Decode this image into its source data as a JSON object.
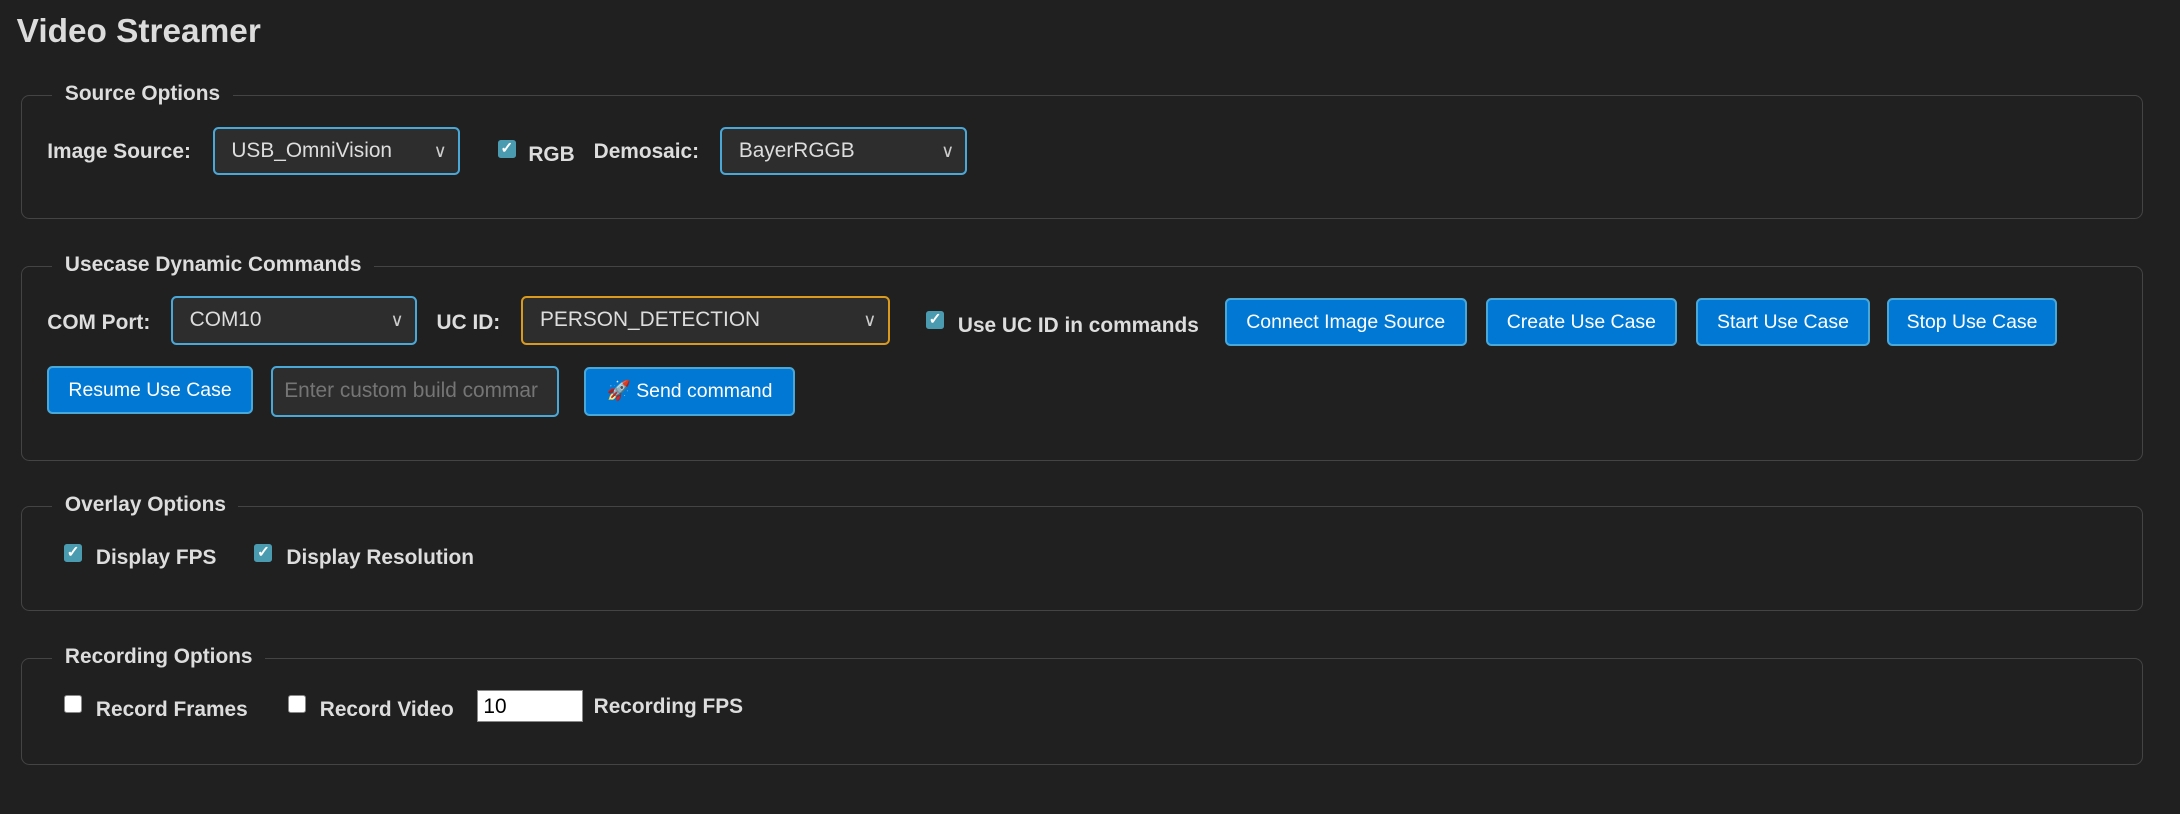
{
  "title": "Video Streamer",
  "source_options": {
    "legend": "Source Options",
    "image_source_label": "Image Source:",
    "image_source_value": "USB_OmniVision",
    "rgb_label": "RGB",
    "rgb_checked": true,
    "demosaic_label": "Demosaic:",
    "demosaic_value": "BayerRGGB"
  },
  "usecase": {
    "legend": "Usecase Dynamic Commands",
    "com_port_label": "COM Port:",
    "com_port_value": "COM10",
    "uc_id_label": "UC ID:",
    "uc_id_value": "PERSON_DETECTION",
    "use_uc_id_label": "Use UC ID in commands",
    "use_uc_id_checked": true,
    "buttons": {
      "connect": "Connect Image Source",
      "create": "Create Use Case",
      "start": "Start Use Case",
      "stop": "Stop Use Case",
      "resume": "Resume Use Case",
      "send": "Send command"
    },
    "send_icon": "🚀",
    "custom_command_placeholder": "Enter custom build commar"
  },
  "overlay": {
    "legend": "Overlay Options",
    "display_fps_label": "Display FPS",
    "display_resolution_label": "Display Resolution"
  },
  "recording": {
    "legend": "Recording Options",
    "record_frames_label": "Record Frames",
    "record_video_label": "Record Video",
    "fps_value": "10",
    "fps_label": "Recording FPS"
  },
  "colors": {
    "accent": "#0078d4",
    "focus_border": "#4aa8d8",
    "uc_border": "#d99a1e",
    "background": "#202020"
  }
}
